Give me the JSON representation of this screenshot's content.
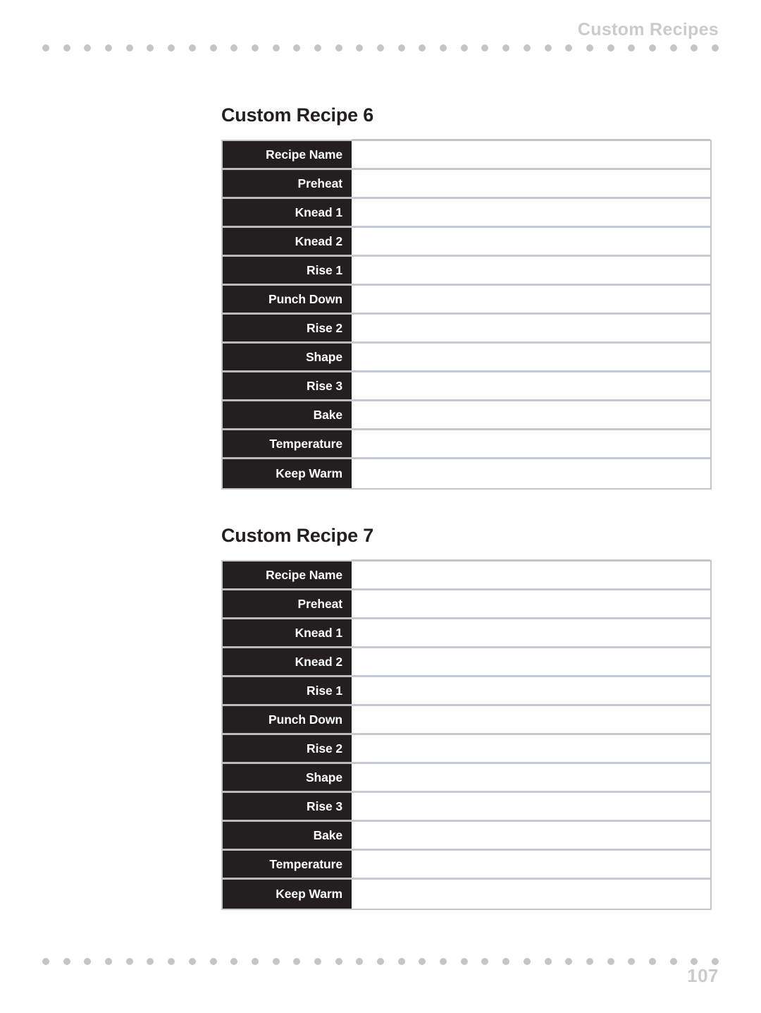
{
  "header": {
    "running_title": "Custom Recipes"
  },
  "footer": {
    "page_number": "107"
  },
  "decor": {
    "dot_count": 33,
    "dot_color": "#c3c5c7",
    "accent_text_color": "#c9cbcd"
  },
  "colors": {
    "label_background": "#231f20",
    "label_text": "#ffffff",
    "table_border": "#c3c5c7",
    "value_rule": "#c6c8d4",
    "title_text": "#231f20"
  },
  "row_labels": [
    "Recipe Name",
    "Preheat",
    "Knead 1",
    "Knead 2",
    "Rise 1",
    "Punch Down",
    "Rise 2",
    "Shape",
    "Rise 3",
    "Bake",
    "Temperature",
    "Keep Warm"
  ],
  "recipes": [
    {
      "title": "Custom Recipe 6",
      "values": [
        "",
        "",
        "",
        "",
        "",
        "",
        "",
        "",
        "",
        "",
        "",
        ""
      ]
    },
    {
      "title": "Custom Recipe 7",
      "values": [
        "",
        "",
        "",
        "",
        "",
        "",
        "",
        "",
        "",
        "",
        "",
        ""
      ]
    }
  ]
}
